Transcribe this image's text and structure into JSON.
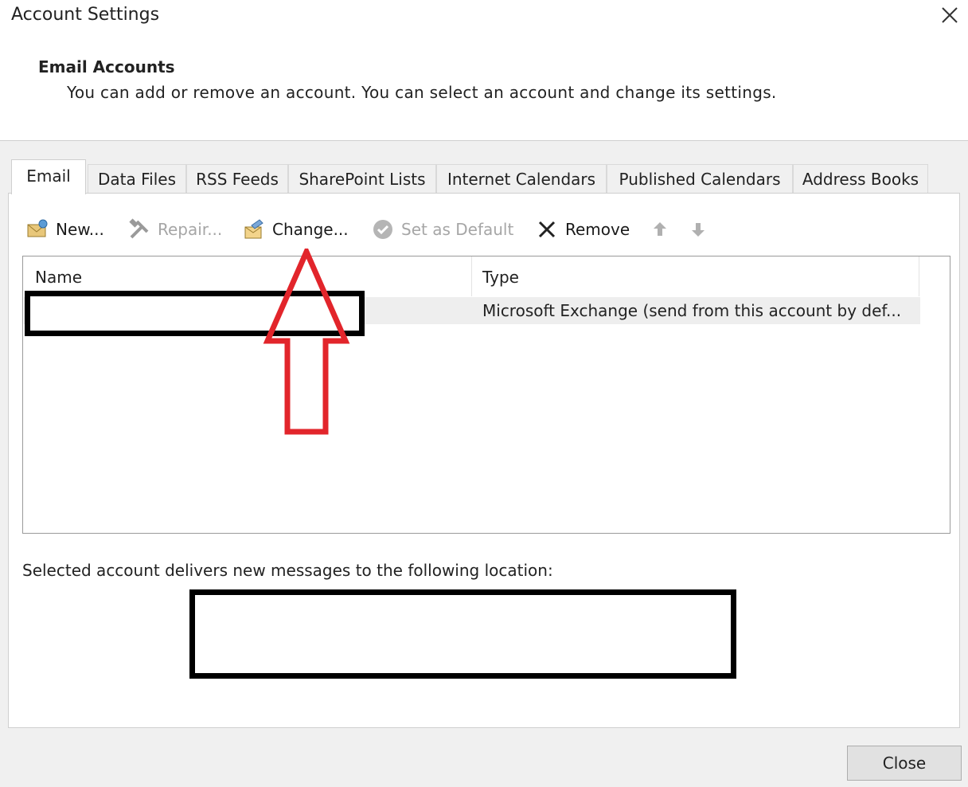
{
  "window": {
    "title": "Account Settings"
  },
  "header": {
    "section_title": "Email Accounts",
    "description": "You can add or remove an account. You can select an account and change its settings."
  },
  "tabs": [
    {
      "label": "Email",
      "active": true
    },
    {
      "label": "Data Files",
      "active": false
    },
    {
      "label": "RSS Feeds",
      "active": false
    },
    {
      "label": "SharePoint Lists",
      "active": false
    },
    {
      "label": "Internet Calendars",
      "active": false
    },
    {
      "label": "Published Calendars",
      "active": false
    },
    {
      "label": "Address Books",
      "active": false
    }
  ],
  "toolbar": {
    "new_label": "New...",
    "repair_label": "Repair...",
    "change_label": "Change...",
    "set_default_label": "Set as Default",
    "remove_label": "Remove",
    "icons": [
      "new-account-icon",
      "repair-icon",
      "change-icon",
      "set-default-icon",
      "remove-icon",
      "move-up-icon",
      "move-down-icon"
    ]
  },
  "account_list": {
    "columns": [
      "Name",
      "Type"
    ],
    "rows": [
      {
        "name": "",
        "type": "Microsoft Exchange (send from this account by def..."
      }
    ]
  },
  "delivery": {
    "label": "Selected account delivers new messages to the following location:"
  },
  "footer": {
    "close_label": "Close"
  },
  "colors": {
    "annotation_arrow": "#e2252b",
    "redaction": "#000000",
    "dialog_background": "#f0f0f0"
  }
}
